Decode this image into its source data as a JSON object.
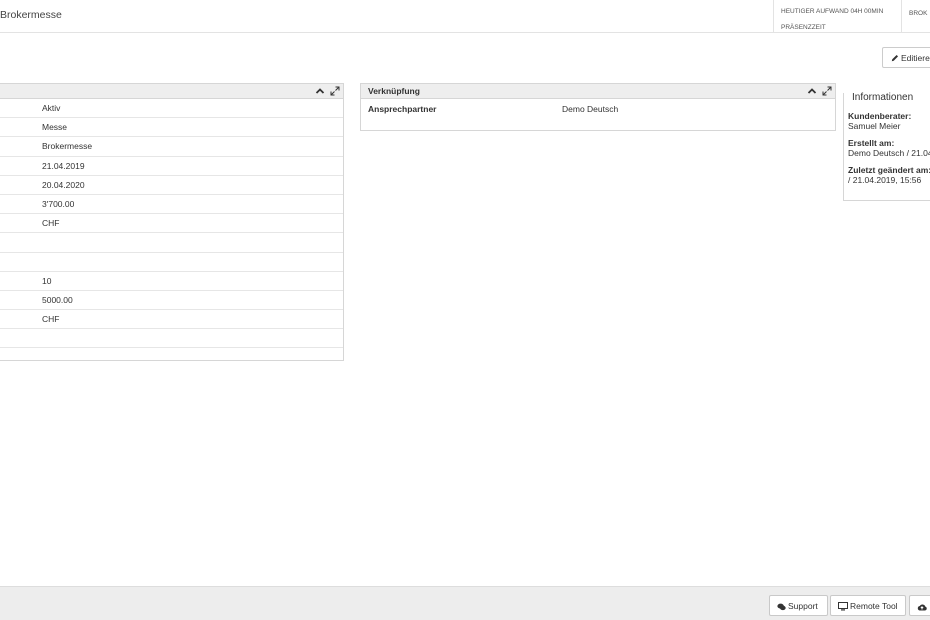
{
  "header": {
    "title": "Brokermesse",
    "effort_label": "HEUTIGER AUFWAND 04H 00MIN",
    "presence_label": "PRÄSENZZEIT",
    "right_label": "BROK"
  },
  "toolbar": {
    "edit_label": "Editiere"
  },
  "details_panel": {
    "rows": [
      {
        "value": "Aktiv"
      },
      {
        "value": "Messe"
      },
      {
        "value": "Brokermesse"
      },
      {
        "value": "21.04.2019"
      },
      {
        "value": "20.04.2020"
      },
      {
        "value": "3'700.00"
      },
      {
        "value": "CHF"
      },
      {
        "value": ""
      },
      {
        "value": ""
      },
      {
        "value": "10"
      },
      {
        "value": "5000.00"
      },
      {
        "value": "CHF"
      },
      {
        "value": ""
      }
    ]
  },
  "link_panel": {
    "title": "Verknüpfung",
    "rows": [
      {
        "label": "Ansprechpartner",
        "value": "Demo Deutsch"
      }
    ]
  },
  "info": {
    "title": "Informationen",
    "advisor_label": "Kundenberater:",
    "advisor_value": "Samuel Meier",
    "created_label": "Erstellt am:",
    "created_value": "Demo Deutsch / 21.04",
    "modified_label": "Zuletzt geändert am:",
    "modified_value": "/ 21.04.2019, 15:56"
  },
  "footer": {
    "support_label": "Support",
    "remote_label": "Remote Tool"
  },
  "colors": {
    "panel_header_bg": "#eeeeee",
    "border": "#d6d6d6",
    "footer_bg": "#ededed"
  }
}
